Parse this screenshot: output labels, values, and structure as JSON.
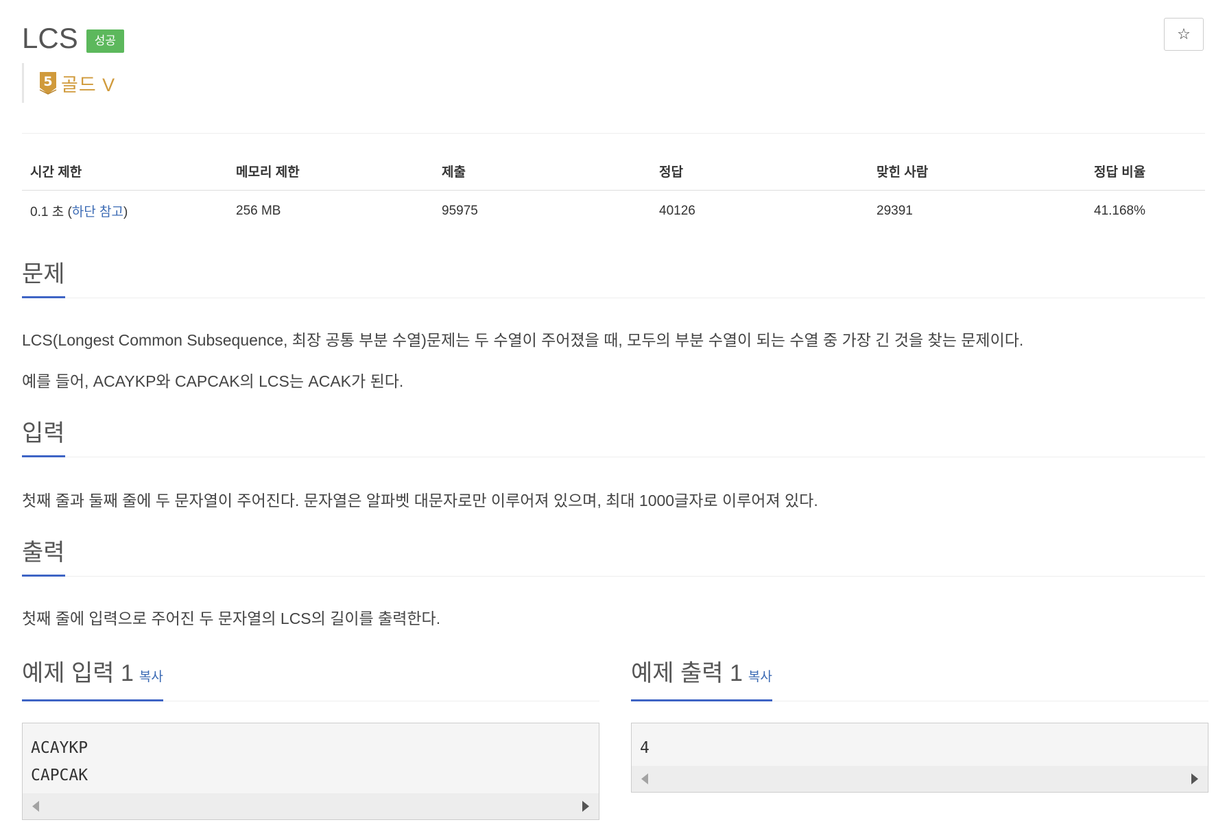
{
  "problem": {
    "title": "LCS",
    "status_badge": "성공",
    "star_label": "☆",
    "tier_number": "5",
    "tier_label": "골드 V"
  },
  "info_table": {
    "headers": [
      "시간 제한",
      "메모리 제한",
      "제출",
      "정답",
      "맞힌 사람",
      "정답 비율"
    ],
    "time_limit_prefix": "0.1 초 (",
    "time_limit_link": "하단 참고",
    "time_limit_suffix": ")",
    "memory_limit": "256 MB",
    "submissions": "95975",
    "accepted": "40126",
    "solvers": "29391",
    "accept_ratio": "41.168%"
  },
  "sections": {
    "description_heading": "문제",
    "description_p1": "LCS(Longest Common Subsequence, 최장 공통 부분 수열)문제는 두 수열이 주어졌을 때, 모두의 부분 수열이 되는 수열 중 가장 긴 것을 찾는 문제이다.",
    "description_p2": "예를 들어, ACAYKP와 CAPCAK의 LCS는 ACAK가 된다.",
    "input_heading": "입력",
    "input_text": "첫째 줄과 둘째 줄에 두 문자열이 주어진다. 문자열은 알파벳 대문자로만 이루어져 있으며, 최대 1000글자로 이루어져 있다.",
    "output_heading": "출력",
    "output_text": "첫째 줄에 입력으로 주어진 두 문자열의 LCS의 길이를 출력한다."
  },
  "samples": {
    "input_heading": "예제 입력 1",
    "input_copy": "복사",
    "input_lines": [
      "ACAYKP",
      "CAPCAK"
    ],
    "output_heading": "예제 출력 1",
    "output_copy": "복사",
    "output_lines": [
      "4"
    ]
  },
  "colors": {
    "success": "#5cb85c",
    "tier_gold": "#d09a3b",
    "link": "#3c6bb4",
    "heading_underline": "#3e64c5"
  }
}
